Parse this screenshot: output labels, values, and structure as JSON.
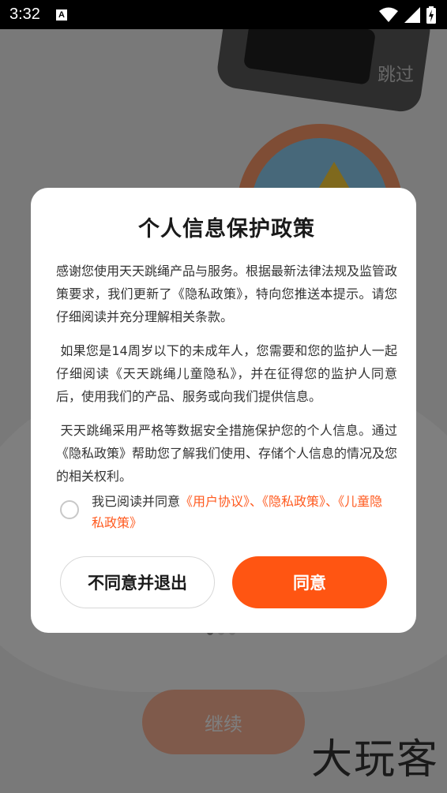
{
  "status_bar": {
    "time": "3:32",
    "notification_icon": "A"
  },
  "background": {
    "skip_label": "跳过",
    "continue_label": "继续",
    "page_dots": {
      "count": 3,
      "active_index": 0
    }
  },
  "dialog": {
    "title": "个人信息保护政策",
    "paragraphs": [
      "感谢您使用天天跳绳产品与服务。根据最新法律法规及监管政策要求，我们更新了《隐私政策》，特向您推送本提示。请您仔细阅读并充分理解相关条款。",
      " 如果您是14周岁以下的未成年人，您需要和您的监护人一起仔细阅读《天天跳绳儿童隐私》，并在征得您的监护人同意后，使用我们的产品、服务或向我们提供信息。",
      " 天天跳绳采用严格等数据安全措施保护您的个人信息。通过《隐私政策》帮助您了解我们使用、存储个人信息的情况及您的相关权利。"
    ],
    "consent": {
      "prefix": "我已阅读并同意",
      "user_agreement": "《用户协议》",
      "sep1": "、",
      "privacy_policy": "《隐私政策》",
      "sep2": "、",
      "child_privacy": "《儿童隐私政策》",
      "checked": false
    },
    "buttons": {
      "disagree": "不同意并退出",
      "agree": "同意"
    }
  },
  "watermark": "大玩客",
  "colors": {
    "accent": "#ff5512",
    "link": "#ff5a1f",
    "scrim": "rgba(0,0,0,0.5)"
  },
  "icons": [
    "wifi-icon",
    "cellular-signal-icon",
    "battery-charging-icon"
  ]
}
